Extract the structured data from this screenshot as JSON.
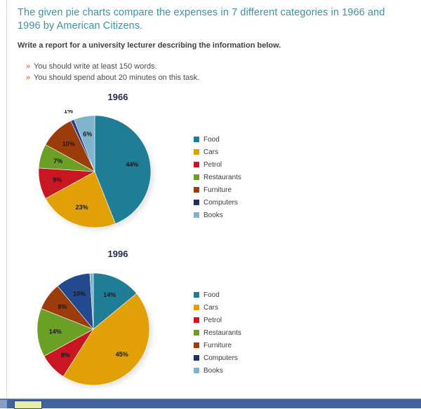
{
  "prompt": {
    "heading": "The given pie charts compare the expenses in 7 different categories in 1966 and 1996 by American Citizens.",
    "instruction": "Write a report for a university lecturer describing the information below.",
    "bullets": [
      "You should write at least 150 words.",
      "You should spend about 20 minutes on this task."
    ],
    "bullet_marker": "»",
    "heading_color": "#3e91a7",
    "bullet_marker_color": "#e8562a"
  },
  "legend": {
    "items": [
      {
        "label": "Food",
        "color": "#1f7d96"
      },
      {
        "label": "Cars",
        "color": "#e0a006"
      },
      {
        "label": "Petrol",
        "color": "#c81722"
      },
      {
        "label": "Restaurants",
        "color": "#6aa024"
      },
      {
        "label": "Furniture",
        "color": "#9c3c0b"
      },
      {
        "label": "Computers",
        "color": "#1f3068"
      },
      {
        "label": "Books",
        "color": "#7fb4cc"
      }
    ]
  },
  "chart_data": [
    {
      "type": "pie",
      "title": "1966",
      "categories": [
        "Food",
        "Cars",
        "Petrol",
        "Restaurants",
        "Furniture",
        "Computers",
        "Books"
      ],
      "values": [
        44,
        23,
        9,
        7,
        10,
        1,
        6
      ],
      "labels": [
        "44%",
        "23%",
        "9%",
        "7%",
        "10%",
        "1%",
        "6%"
      ],
      "colors": [
        "#1f7d96",
        "#e0a006",
        "#c81722",
        "#6aa024",
        "#9c3c0b",
        "#2c3d84",
        "#7fb4cc"
      ],
      "unit": "%",
      "legend_position": "right",
      "start_angle_deg": 0,
      "direction": "clockwise"
    },
    {
      "type": "pie",
      "title": "1996",
      "categories": [
        "Food",
        "Cars",
        "Petrol",
        "Restaurants",
        "Furniture",
        "Computers",
        "Books"
      ],
      "values": [
        14,
        45,
        8,
        14,
        8,
        10,
        1
      ],
      "labels": [
        "14%",
        "45%",
        "8%",
        "14%",
        "8%",
        "10%",
        "1%"
      ],
      "colors": [
        "#1f7d96",
        "#e0a006",
        "#c81722",
        "#6aa024",
        "#9c3c0b",
        "#234a8e",
        "#7fb4cc"
      ],
      "unit": "%",
      "legend_position": "right",
      "start_angle_deg": 0,
      "direction": "clockwise"
    }
  ],
  "taskbar": {
    "visible": true,
    "color": "#41649d"
  }
}
